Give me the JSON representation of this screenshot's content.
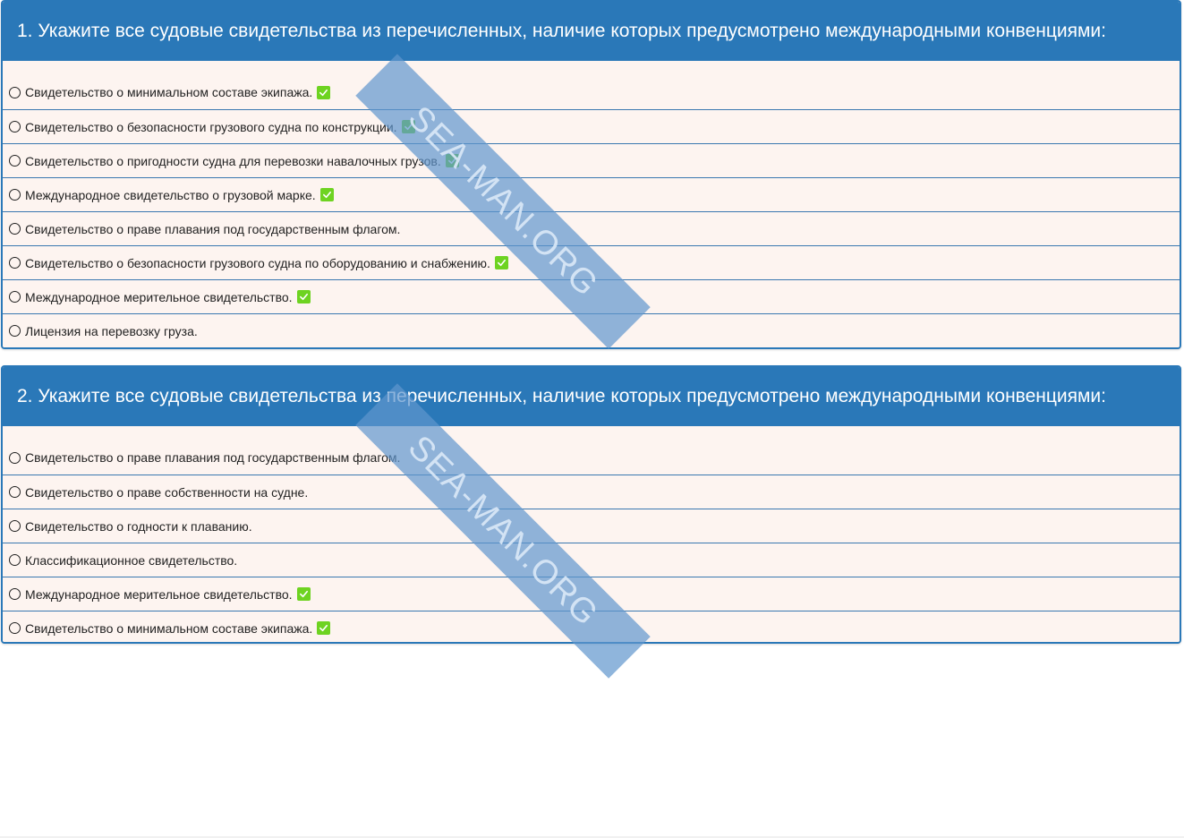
{
  "questions": [
    {
      "title": "1. Укажите все судовые свидетельства из перечисленных, наличие которых предусмотрено международными конвенциями:",
      "answers": [
        {
          "text": "Свидетельство о минимальном составе экипажа.",
          "correct": true
        },
        {
          "text": "Свидетельство о безопасности грузового судна по конструкции.",
          "correct": true
        },
        {
          "text": "Свидетельство о пригодности судна для перевозки навалочных грузов.",
          "correct": true
        },
        {
          "text": "Международное свидетельство о грузовой марке.",
          "correct": true
        },
        {
          "text": "Свидетельство о праве плавания под государственным флагом.",
          "correct": false
        },
        {
          "text": "Свидетельство о безопасности грузового судна по оборудованию и снабжению.",
          "correct": true
        },
        {
          "text": "Международное мерительное свидетельство.",
          "correct": true
        },
        {
          "text": "Лицензия на перевозку груза.",
          "correct": false
        }
      ]
    },
    {
      "title": "2. Укажите все судовые свидетельства из перечисленных, наличие которых предусмотрено международными конвенциями:",
      "answers": [
        {
          "text": "Свидетельство о праве плавания под государственным флагом.",
          "correct": false
        },
        {
          "text": "Свидетельство о праве собственности на судне.",
          "correct": false
        },
        {
          "text": "Свидетельство о годности к плаванию.",
          "correct": false
        },
        {
          "text": "Классификационное свидетельство.",
          "correct": false
        },
        {
          "text": "Международное мерительное свидетельство.",
          "correct": true
        },
        {
          "text": "Свидетельство о минимальном составе экипажа.",
          "correct": true
        }
      ]
    }
  ],
  "watermark": "SEA-MAN.ORG",
  "icons": {
    "radio": "radio-circle-icon",
    "check": "green-checkmark-icon"
  },
  "colors": {
    "header": "#2a78b8",
    "answer_bg": "#fdf4f0",
    "check": "#6ed321"
  }
}
